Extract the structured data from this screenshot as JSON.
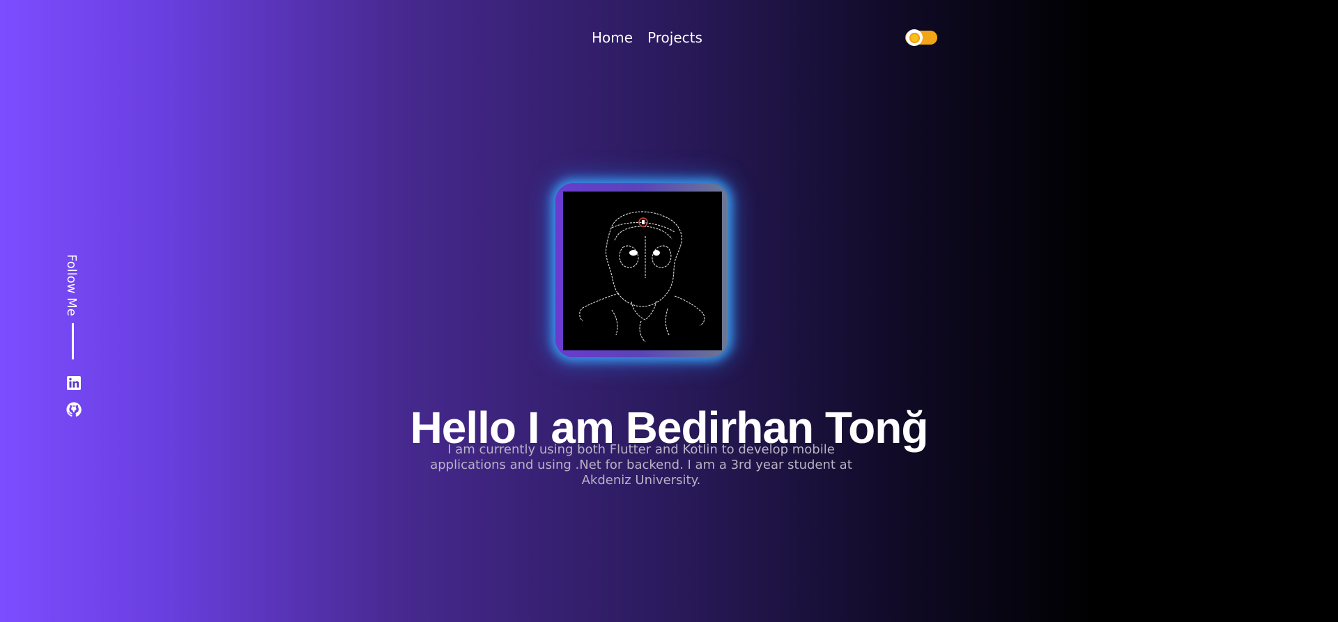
{
  "nav": {
    "home": "Home",
    "projects": "Projects"
  },
  "theme_toggle": {
    "icon": "sun-icon",
    "state": "light",
    "track_color": "#f2a516"
  },
  "sidebar": {
    "follow_label": "Follow Me",
    "social": [
      {
        "icon": "linkedin-icon"
      },
      {
        "icon": "github-icon"
      }
    ]
  },
  "hero": {
    "title": "Hello I am Bedirhan Tonğ",
    "description": "I am currently using both Flutter and Kotlin to develop mobile applications and using .Net for backend. I am a 3rd year student at Akdeniz University.",
    "avatar": "line-art-portrait"
  },
  "colors": {
    "gradient_start": "#7c4dff",
    "gradient_end": "#000000",
    "glow": "#3caaff"
  }
}
